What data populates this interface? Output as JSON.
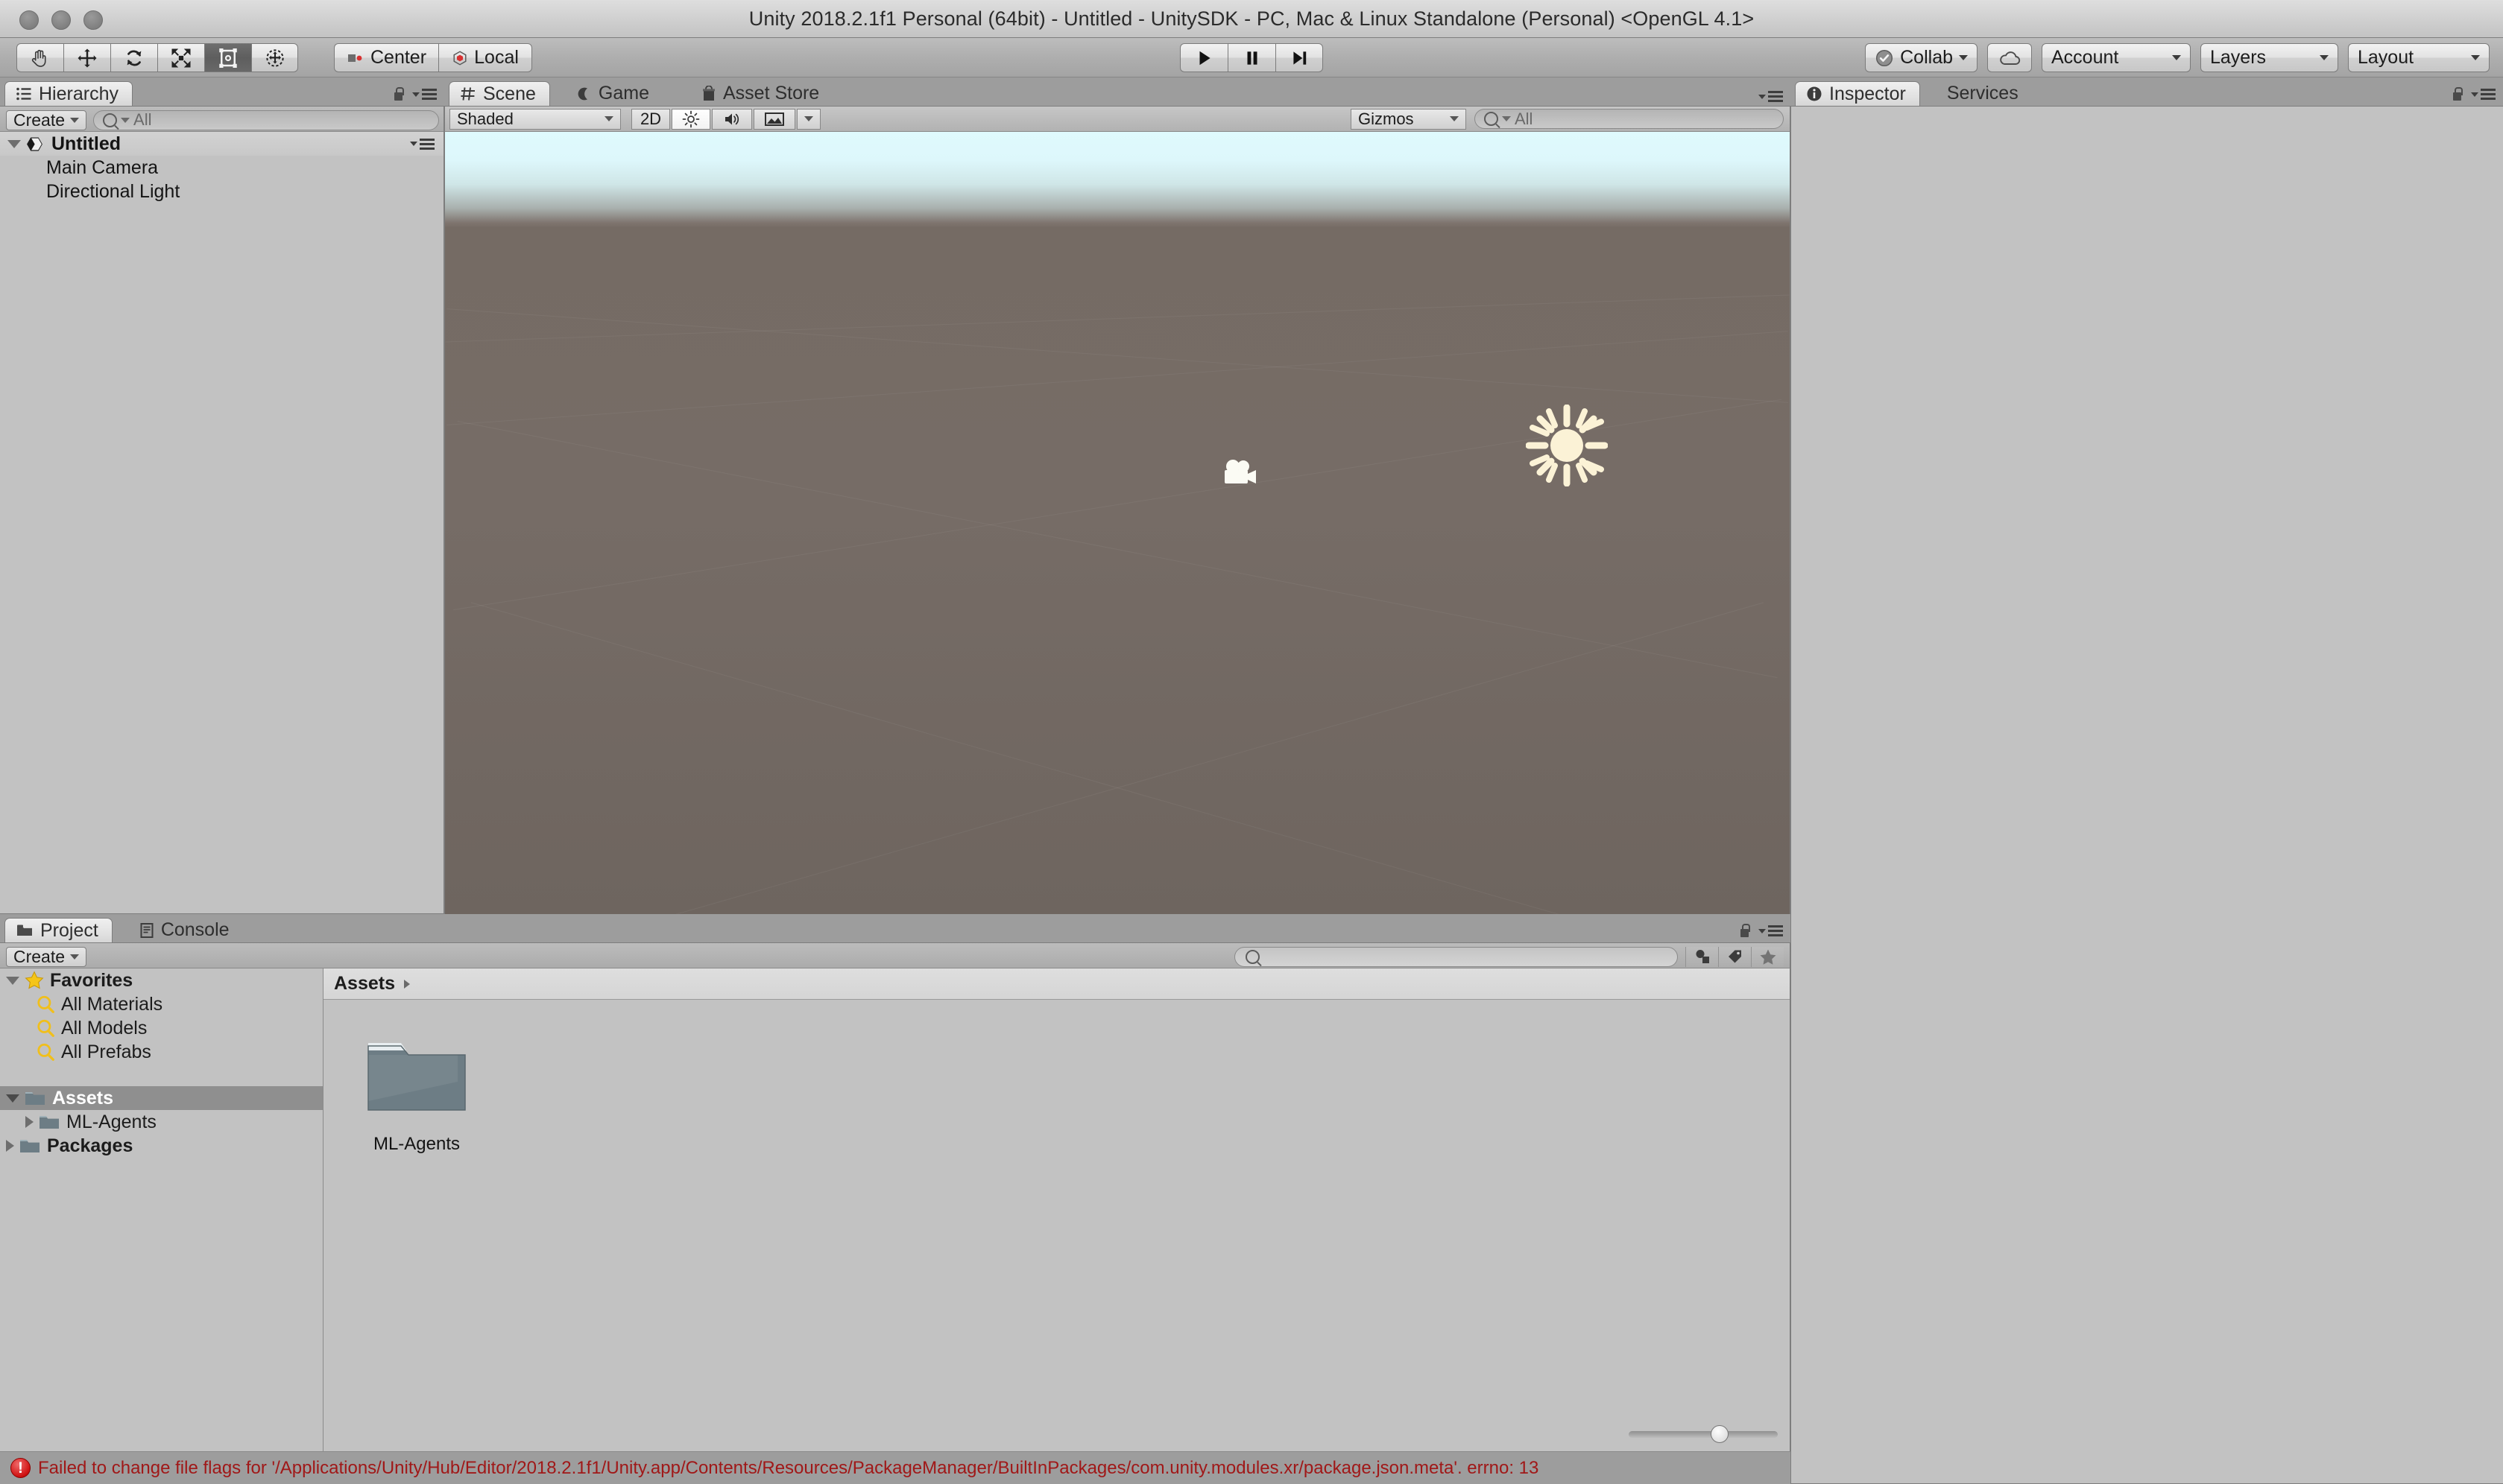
{
  "window": {
    "title": "Unity 2018.2.1f1 Personal (64bit) - Untitled - UnitySDK - PC, Mac & Linux Standalone (Personal) <OpenGL 4.1>",
    "traffic_lights": [
      "close",
      "minimize",
      "maximize"
    ]
  },
  "toolbar": {
    "transform_tools": [
      {
        "name": "hand-tool",
        "icon": "hand",
        "active": false
      },
      {
        "name": "move-tool",
        "icon": "move",
        "active": false
      },
      {
        "name": "rotate-tool",
        "icon": "rotate",
        "active": false
      },
      {
        "name": "scale-tool",
        "icon": "scale",
        "active": false
      },
      {
        "name": "rect-tool",
        "icon": "rect-transform",
        "active": true
      },
      {
        "name": "transform-tool",
        "icon": "transform-combined",
        "active": false
      }
    ],
    "pivot_mode": "Center",
    "pivot_rotation": "Local",
    "play_controls": [
      {
        "name": "play-button",
        "glyph": "play"
      },
      {
        "name": "pause-button",
        "glyph": "pause"
      },
      {
        "name": "step-button",
        "glyph": "step"
      }
    ],
    "collab_label": "Collab",
    "cloud_label": "",
    "account_label": "Account",
    "layers_label": "Layers",
    "layout_label": "Layout"
  },
  "hierarchy": {
    "tab_label": "Hierarchy",
    "create_label": "Create",
    "search_placeholder": "All",
    "scene_name": "Untitled",
    "objects": [
      {
        "name": "Main Camera"
      },
      {
        "name": "Directional Light"
      }
    ]
  },
  "scene": {
    "tabs": [
      {
        "label": "Scene",
        "selected": true,
        "icon": "grid-icon"
      },
      {
        "label": "Game",
        "selected": false,
        "icon": "gamepad-icon"
      },
      {
        "label": "Asset Store",
        "selected": false,
        "icon": "store-icon"
      }
    ],
    "draw_mode": "Shaded",
    "dimension_toggle": "2D",
    "lighting_toggle": "lighting-icon",
    "audio_toggle": "audio-icon",
    "effects_toggle": "image-icon",
    "gizmos_label": "Gizmos",
    "gizmo_search_placeholder": "All",
    "gizmos_in_view": [
      {
        "name": "camera-gizmo",
        "label": "Main Camera"
      },
      {
        "name": "light-gizmo",
        "label": "Directional Light"
      }
    ]
  },
  "inspector": {
    "tabs": [
      {
        "label": "Inspector",
        "selected": true
      },
      {
        "label": "Services",
        "selected": false
      }
    ],
    "content": ""
  },
  "project": {
    "tabs": [
      {
        "label": "Project",
        "selected": true,
        "icon": "folder-icon"
      },
      {
        "label": "Console",
        "selected": false,
        "icon": "console-icon"
      }
    ],
    "create_label": "Create",
    "search_placeholder": "",
    "tree": [
      {
        "label": "Favorites",
        "type": "favorites",
        "expanded": true,
        "depth": 0,
        "bold": true,
        "selected": false
      },
      {
        "label": "All Materials",
        "type": "saved-search",
        "depth": 1,
        "bold": false,
        "selected": false
      },
      {
        "label": "All Models",
        "type": "saved-search",
        "depth": 1,
        "bold": false,
        "selected": false
      },
      {
        "label": "All Prefabs",
        "type": "saved-search",
        "depth": 1,
        "bold": false,
        "selected": false
      },
      {
        "label": "Assets",
        "type": "folder",
        "expanded": true,
        "depth": 0,
        "bold": true,
        "selected": true
      },
      {
        "label": "ML-Agents",
        "type": "folder",
        "expanded": false,
        "depth": 1,
        "bold": false,
        "selected": false
      },
      {
        "label": "Packages",
        "type": "folder",
        "expanded": false,
        "depth": 0,
        "bold": true,
        "selected": false
      }
    ],
    "breadcrumb": "Assets",
    "assets": [
      {
        "label": "ML-Agents",
        "type": "folder"
      }
    ],
    "zoom_value": 55
  },
  "status": {
    "message": "Failed to change file flags for '/Applications/Unity/Hub/Editor/2018.2.1f1/Unity.app/Contents/Resources/PackageManager/BuiltInPackages/com.unity.modules.xr/package.json.meta'. errno: 13",
    "severity": "error"
  },
  "colors": {
    "chrome": "#9d9d9d",
    "panel": "#c2c2c2",
    "error_text": "#a01818",
    "selection": "#8f8f8f",
    "accent_yellow": "#f5c518"
  }
}
